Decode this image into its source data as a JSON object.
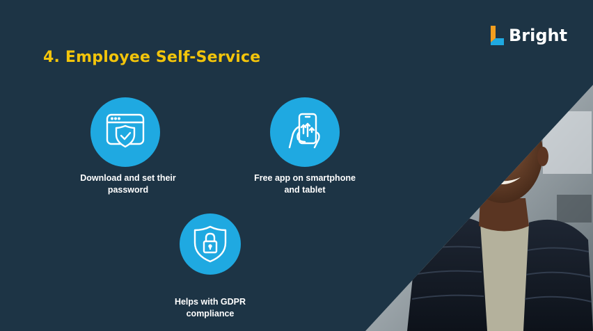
{
  "slide": {
    "title": "4. Employee Self-Service",
    "logo_text": "Bright",
    "colors": {
      "background": "#1d3445",
      "title": "#f2c40b",
      "accent_circle": "#1fa9e1",
      "logo_orange": "#f29e1f",
      "logo_blue": "#1fa9e1"
    }
  },
  "features": [
    {
      "icon": "browser-shield-icon",
      "caption_line1": "Download and set their",
      "caption_line2": "password"
    },
    {
      "icon": "smartphone-hand-icon",
      "caption_line1": "Free app on smartphone",
      "caption_line2": "and tablet"
    },
    {
      "icon": "shield-lock-icon",
      "caption_line1": "Helps with GDPR",
      "caption_line2": "compliance"
    }
  ],
  "photo": {
    "subject": "smiling-man-photo"
  }
}
